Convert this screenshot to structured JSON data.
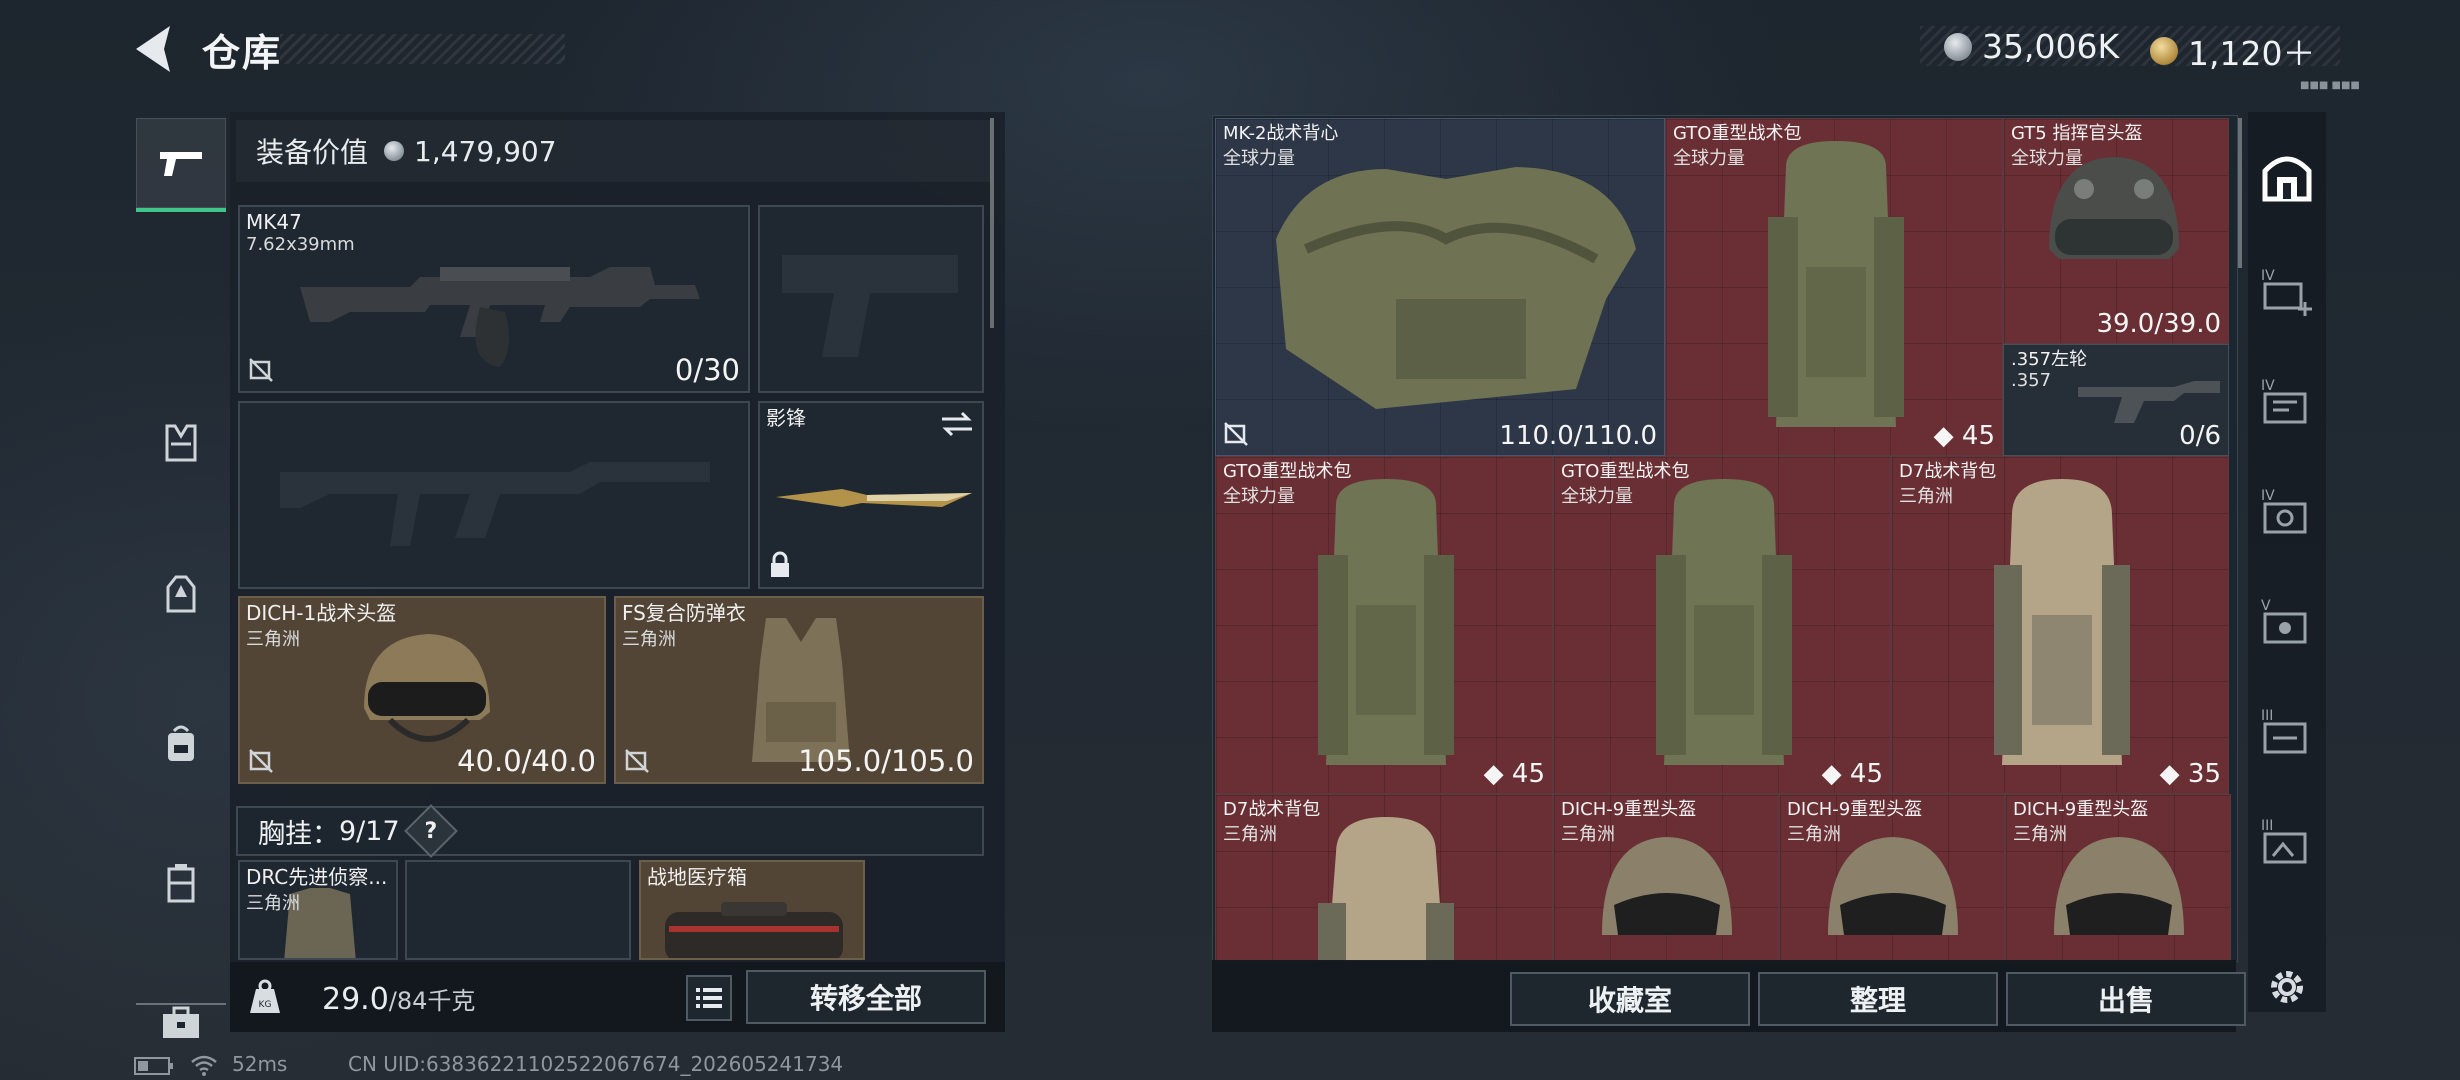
{
  "header": {
    "title": "仓库",
    "currency_silver": "35,006K",
    "currency_gold": "1,120＋",
    "corner_tag": "■■■ ■■■"
  },
  "left_rail": {
    "items": [
      "pistol-icon",
      "vest-icon",
      "helmet-icon",
      "backpack-icon",
      "chest-rig-icon",
      "toolbox-icon"
    ],
    "active": "pistol-icon"
  },
  "equipment": {
    "value_label": "装备价值",
    "value": "1,479,907",
    "primary_weapon": {
      "name": "MK47",
      "caliber": "7.62x39mm",
      "ammo": "0/30"
    },
    "melee": {
      "name": "影锋"
    },
    "helmet": {
      "name": "DICH-1战术头盔",
      "source": "三角洲",
      "durability": "40.0/40.0"
    },
    "armor": {
      "name": "FS复合防弹衣",
      "source": "三角洲",
      "durability": "105.0/105.0"
    },
    "chest_rig_label": "胸挂：",
    "chest_rig_count": "9/17",
    "chest_rig_help": "?",
    "rig_item1": {
      "name": "DRC先进侦察...",
      "source": "三角洲"
    },
    "rig_item2": {
      "name": "战地医疗箱"
    },
    "weight": "29.0",
    "weight_max": "/84千克",
    "transfer_all": "转移全部"
  },
  "stash": {
    "items": [
      {
        "name": "MK-2战术背心",
        "source": "全球力量",
        "value": "110.0/110.0",
        "bg": "grey"
      },
      {
        "name": "GTO重型战术包",
        "source": "全球力量",
        "value": "45"
      },
      {
        "name": "GT5 指挥官头盔",
        "source": "全球力量",
        "value": "39.0/39.0"
      },
      {
        "name": ".357左轮",
        "source": ".357",
        "value": "0/6",
        "bg": "dark"
      },
      {
        "name": "GTO重型战术包",
        "source": "全球力量",
        "value": "45"
      },
      {
        "name": "GTO重型战术包",
        "source": "全球力量",
        "value": "45"
      },
      {
        "name": "D7战术背包",
        "source": "三角洲",
        "value": "35"
      },
      {
        "name": "D7战术背包",
        "source": "三角洲",
        "value": ""
      },
      {
        "name": "DICH-9重型头盔",
        "source": "三角洲",
        "value": ""
      },
      {
        "name": "DICH-9重型头盔",
        "source": "三角洲",
        "value": ""
      },
      {
        "name": "DICH-9重型头盔",
        "source": "三角洲",
        "value": ""
      }
    ],
    "collection_btn": "收藏室",
    "sort_btn": "整理",
    "sell_btn": "出售"
  },
  "right_rail": {
    "items": [
      "safe-house-icon",
      "stash-tab-iv-add-icon",
      "stash-tab-iv-icon",
      "stash-tab-iv-photo-icon",
      "stash-tab-v-icon",
      "stash-tab-iii-icon",
      "stash-tab-iii-photo-icon",
      "settings-icon"
    ],
    "tab_labels": [
      "IV",
      "IV",
      "IV",
      "V",
      "III",
      "III"
    ]
  },
  "status_bar": {
    "ping": "52ms",
    "uid": "CN UID:6383622110252206767­4_202605241734"
  },
  "colors": {
    "accent_green": "#3fc78a",
    "rare_red": "#6a2f35",
    "gold_slot": "#524536"
  }
}
